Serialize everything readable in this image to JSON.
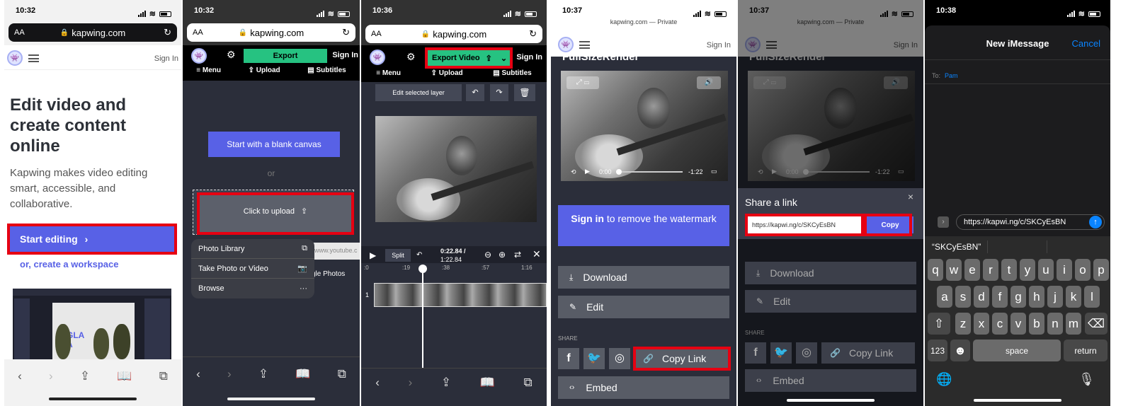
{
  "p1": {
    "time": "10:32",
    "aa": "AA",
    "url": "kapwing.com",
    "signin": "Sign In",
    "headline": "Edit video and create content online",
    "desc": "Kapwing makes video editing smart, accessible, and collaborative.",
    "start_editing": "Start editing",
    "workspace": "or, create a workspace",
    "thumb_text": "GLA A"
  },
  "p2": {
    "time": "10:32",
    "aa": "AA",
    "url": "kapwing.com",
    "export": "Export",
    "signin": "Sign In",
    "menu": "Menu",
    "upload": "Upload",
    "subtitles": "Subtitles",
    "blank_canvas": "Start with a blank canvas",
    "or": "or",
    "click_upload": "Click to upload",
    "url_placeholder": "www.youtube.c",
    "google_photos": "gle Photos",
    "sheet": [
      "Photo Library",
      "Take Photo or Video",
      "Browse"
    ]
  },
  "p3": {
    "time": "10:36",
    "aa": "AA",
    "url": "kapwing.com",
    "export_video": "Export Video",
    "signin": "Sign In",
    "menu": "Menu",
    "upload": "Upload",
    "subtitles": "Subtitles",
    "edit_layer": "Edit selected layer",
    "split": "Split",
    "time_current": "0:22.84 /",
    "time_total": "1:22.84",
    "ticks": [
      ":0",
      ":19",
      ":38",
      ":57",
      "1:16"
    ],
    "track_num": "1"
  },
  "p4": {
    "time": "10:37",
    "private": "kapwing.com — Private",
    "signin": "Sign In",
    "cut_title": "FullSizeRender",
    "vid_time": "0:00",
    "vid_remain": "-1:22",
    "signin_wm_bold": "Sign in",
    "signin_wm_rest": "to remove the watermark",
    "download": "Download",
    "edit": "Edit",
    "share": "SHARE",
    "copy_link": "Copy Link",
    "embed": "Embed"
  },
  "p5": {
    "time": "10:37",
    "private": "kapwing.com — Private",
    "signin": "Sign In",
    "cut_title": "FullSizeRender",
    "vid_time": "0:00",
    "vid_remain": "-1:22",
    "share_title": "Share a link",
    "close": "×",
    "link": "https://kapwi.ng/c/SKCyEsBN",
    "copy": "Copy",
    "download": "Download",
    "edit": "Edit",
    "share": "SHARE",
    "copy_link": "Copy Link",
    "embed": "Embed"
  },
  "p6": {
    "time": "10:38",
    "title": "New iMessage",
    "cancel": "Cancel",
    "to_label": "To:",
    "to_value": "Pam",
    "message": "https://kapwi.ng/c/SKCyEsBN",
    "suggestion": "“SKCyEsBN”",
    "row1": [
      "q",
      "w",
      "e",
      "r",
      "t",
      "y",
      "u",
      "i",
      "o",
      "p"
    ],
    "row2": [
      "a",
      "s",
      "d",
      "f",
      "g",
      "h",
      "j",
      "k",
      "l"
    ],
    "row3": [
      "z",
      "x",
      "c",
      "v",
      "b",
      "n",
      "m"
    ],
    "k123": "123",
    "space": "space",
    "return": "return"
  },
  "colors": {
    "accent": "#5861e6",
    "red": "#e60012",
    "green": "#26c281"
  }
}
